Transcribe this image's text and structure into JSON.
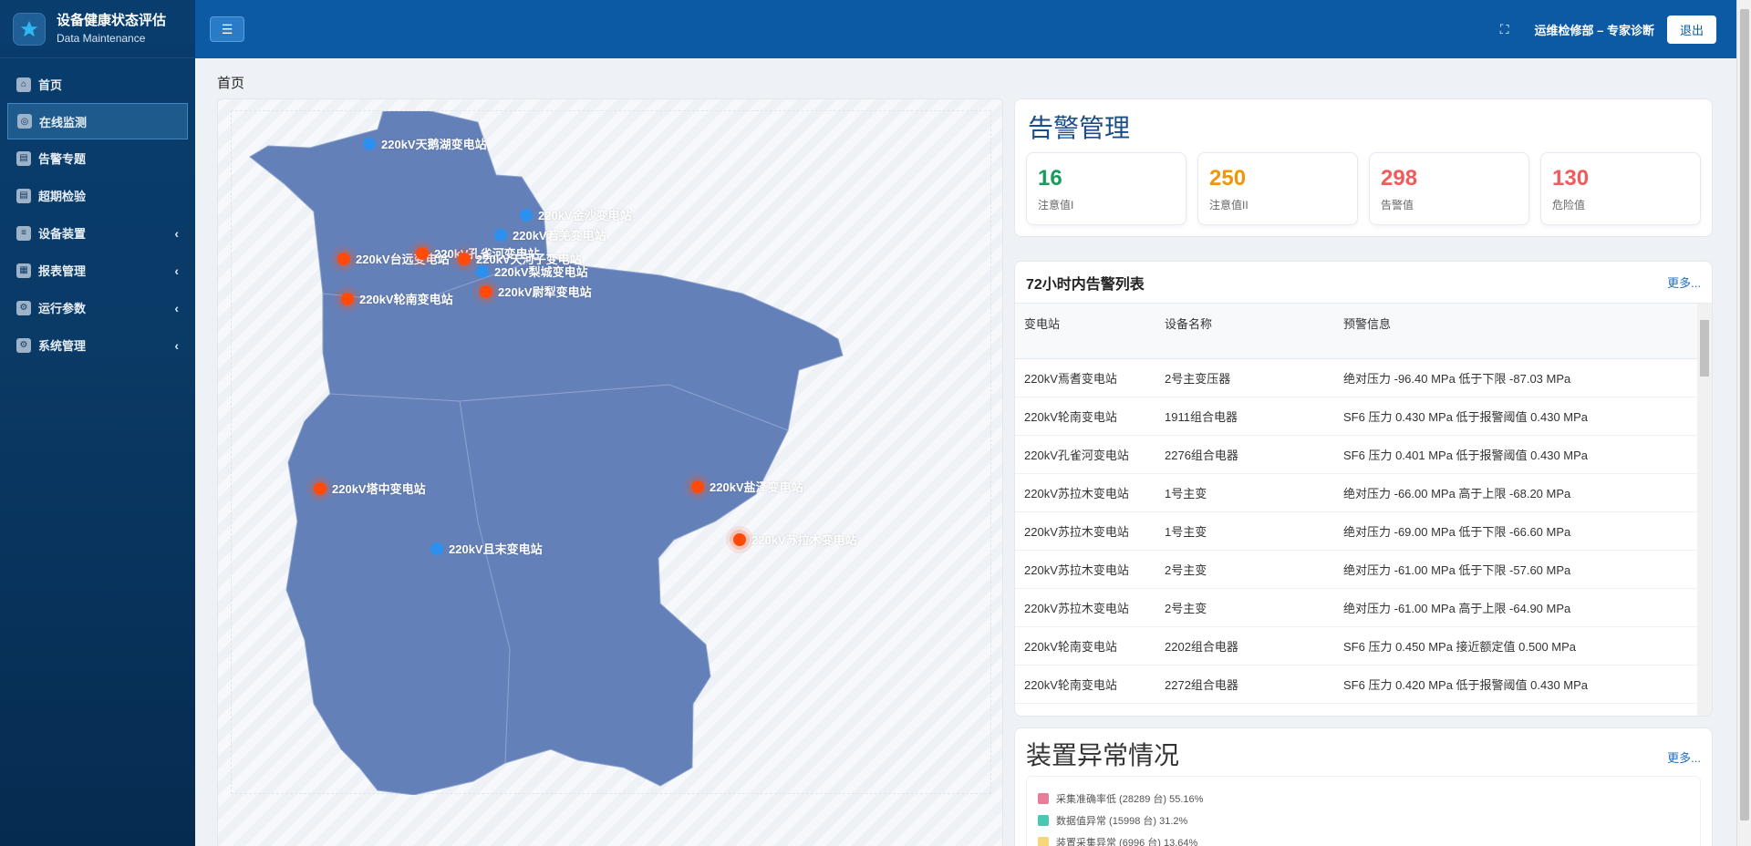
{
  "app": {
    "title": "设备健康状态评估",
    "subtitle": "Data Maintenance"
  },
  "sidebar": {
    "items": [
      {
        "label": "首页",
        "icon": "home-icon",
        "active": false,
        "expandable": false
      },
      {
        "label": "在线监测",
        "icon": "monitor-icon",
        "active": true,
        "expandable": false
      },
      {
        "label": "告警专题",
        "icon": "alarm-icon",
        "active": false,
        "expandable": false
      },
      {
        "label": "超期检验",
        "icon": "overdue-icon",
        "active": false,
        "expandable": false
      },
      {
        "label": "设备装置",
        "icon": "device-icon",
        "active": false,
        "expandable": true
      },
      {
        "label": "报表管理",
        "icon": "report-icon",
        "active": false,
        "expandable": true
      },
      {
        "label": "运行参数",
        "icon": "params-icon",
        "active": false,
        "expandable": true
      },
      {
        "label": "系统管理",
        "icon": "gear-icon",
        "active": false,
        "expandable": true
      }
    ]
  },
  "header": {
    "user": "运维检修部 – 专家诊断",
    "logout": "退出"
  },
  "breadcrumb": "首页",
  "map": {
    "stations": [
      {
        "name": "220kV天鹅湖变电站",
        "status": "normal"
      },
      {
        "name": "220kV金沙变电站",
        "status": "normal"
      },
      {
        "name": "220kV若羌变电站",
        "status": "normal"
      },
      {
        "name": "220kV台远变电站",
        "status": "alarm"
      },
      {
        "name": "220kV孔雀河变电站",
        "status": "alarm"
      },
      {
        "name": "220kV天河子变电站",
        "status": "alarm"
      },
      {
        "name": "220kV梨城变电站",
        "status": "normal"
      },
      {
        "name": "220kV轮南变电站",
        "status": "alarm"
      },
      {
        "name": "220kV尉犁变电站",
        "status": "alarm"
      },
      {
        "name": "220kV塔中变电站",
        "status": "alarm"
      },
      {
        "name": "220kV盐泽变电站",
        "status": "alarm"
      },
      {
        "name": "220kV苏拉木变电站",
        "status": "alarm"
      },
      {
        "name": "220kV且末变电站",
        "status": "normal"
      }
    ]
  },
  "alarm_mgmt": {
    "title": "告警管理",
    "stats": [
      {
        "value": "16",
        "label": "注意值I",
        "color": "#1a9b5c"
      },
      {
        "value": "250",
        "label": "注意值II",
        "color": "#f0960e"
      },
      {
        "value": "298",
        "label": "告警值",
        "color": "#f25b5b"
      },
      {
        "value": "130",
        "label": "危险值",
        "color": "#f25b5b"
      }
    ]
  },
  "alarm_list": {
    "title": "72小时内告警列表",
    "more": "更多...",
    "columns": [
      "变电站",
      "设备名称",
      "预警信息"
    ],
    "rows": [
      [
        "220kV焉耆变电站",
        "2号主变压器",
        "绝对压力 -96.40 MPa 低于下限 -87.03 MPa"
      ],
      [
        "220kV轮南变电站",
        "1911组合电器",
        "SF6 压力 0.430 MPa 低于报警阈值 0.430 MPa"
      ],
      [
        "220kV孔雀河变电站",
        "2276组合电器",
        "SF6 压力 0.401 MPa 低于报警阈值 0.430 MPa"
      ],
      [
        "220kV苏拉木变电站",
        "1号主变",
        "绝对压力 -66.00 MPa 高于上限 -68.20 MPa"
      ],
      [
        "220kV苏拉木变电站",
        "1号主变",
        "绝对压力 -69.00 MPa 低于下限 -66.60 MPa"
      ],
      [
        "220kV苏拉木变电站",
        "2号主变",
        "绝对压力 -61.00 MPa 低于下限 -57.60 MPa"
      ],
      [
        "220kV苏拉木变电站",
        "2号主变",
        "绝对压力 -61.00 MPa 高于上限 -64.90 MPa"
      ],
      [
        "220kV轮南变电站",
        "2202组合电器",
        "SF6 压力 0.450 MPa 接近额定值 0.500 MPa"
      ],
      [
        "220kV轮南变电站",
        "2272组合电器",
        "SF6 压力 0.420 MPa 低于报警阈值 0.430 MPa"
      ]
    ]
  },
  "device_anomaly": {
    "title": "装置异常情况",
    "more": "更多...",
    "legend": [
      {
        "label": "采集准确率低 (28289 台) 55.16%",
        "color": "#e87c9a"
      },
      {
        "label": "数据值异常 (15998 台) 31.2%",
        "color": "#4bc8b4"
      },
      {
        "label": "装置采集异常 (6996 台) 13.64%",
        "color": "#f5d77a"
      }
    ]
  }
}
